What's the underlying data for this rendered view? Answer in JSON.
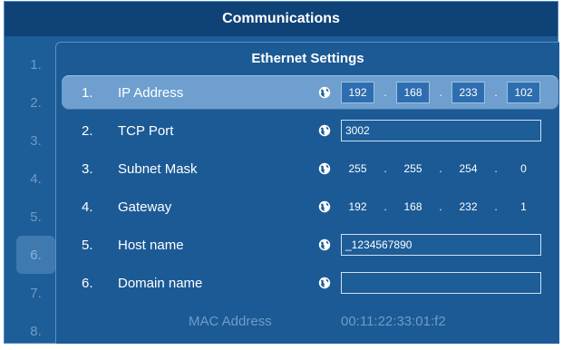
{
  "window": {
    "title": "Communications"
  },
  "side_numbers": [
    "1.",
    "2.",
    "3.",
    "4.",
    "5.",
    "6.",
    "7.",
    "8."
  ],
  "panel": {
    "title": "Ethernet Settings"
  },
  "settings": [
    {
      "num": "1.",
      "label": "IP Address",
      "kind": "ip",
      "octets": [
        "192",
        "168",
        "233",
        "102"
      ],
      "separator": "."
    },
    {
      "num": "2.",
      "label": "TCP Port",
      "kind": "text",
      "value": "3002"
    },
    {
      "num": "3.",
      "label": "Subnet Mask",
      "kind": "ip",
      "octets": [
        "255",
        "255",
        "254",
        "0"
      ],
      "separator": "."
    },
    {
      "num": "4.",
      "label": "Gateway",
      "kind": "ip",
      "octets": [
        "192",
        "168",
        "232",
        "1"
      ],
      "separator": "."
    },
    {
      "num": "5.",
      "label": "Host name",
      "kind": "text",
      "value": "_1234567890"
    },
    {
      "num": "6.",
      "label": "Domain name",
      "kind": "text",
      "value": ""
    }
  ],
  "mac": {
    "label": "MAC Address",
    "value": "00:11:22:33:01:f2"
  },
  "icons": {
    "field_icon": "globe-icon"
  },
  "colors": {
    "background": "#1d5d98",
    "title_bar": "#0f4377",
    "selected_row": "#6e9fce",
    "muted_text": "#6f9cc7"
  }
}
